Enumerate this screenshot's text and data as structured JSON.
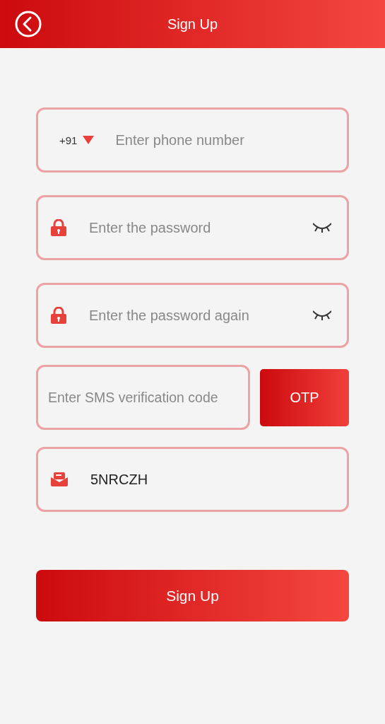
{
  "header": {
    "title": "Sign Up"
  },
  "fields": [
    {
      "kind": "phone",
      "country_code": "+91",
      "placeholder": "Enter phone number"
    },
    {
      "kind": "password",
      "placeholder": "Enter the password"
    },
    {
      "kind": "password",
      "placeholder": "Enter the password again"
    },
    {
      "kind": "code",
      "placeholder": "Enter SMS verification code",
      "button": "OTP"
    },
    {
      "kind": "invite",
      "value": "5NRCZH"
    }
  ],
  "submit_button": "Sign Up"
}
